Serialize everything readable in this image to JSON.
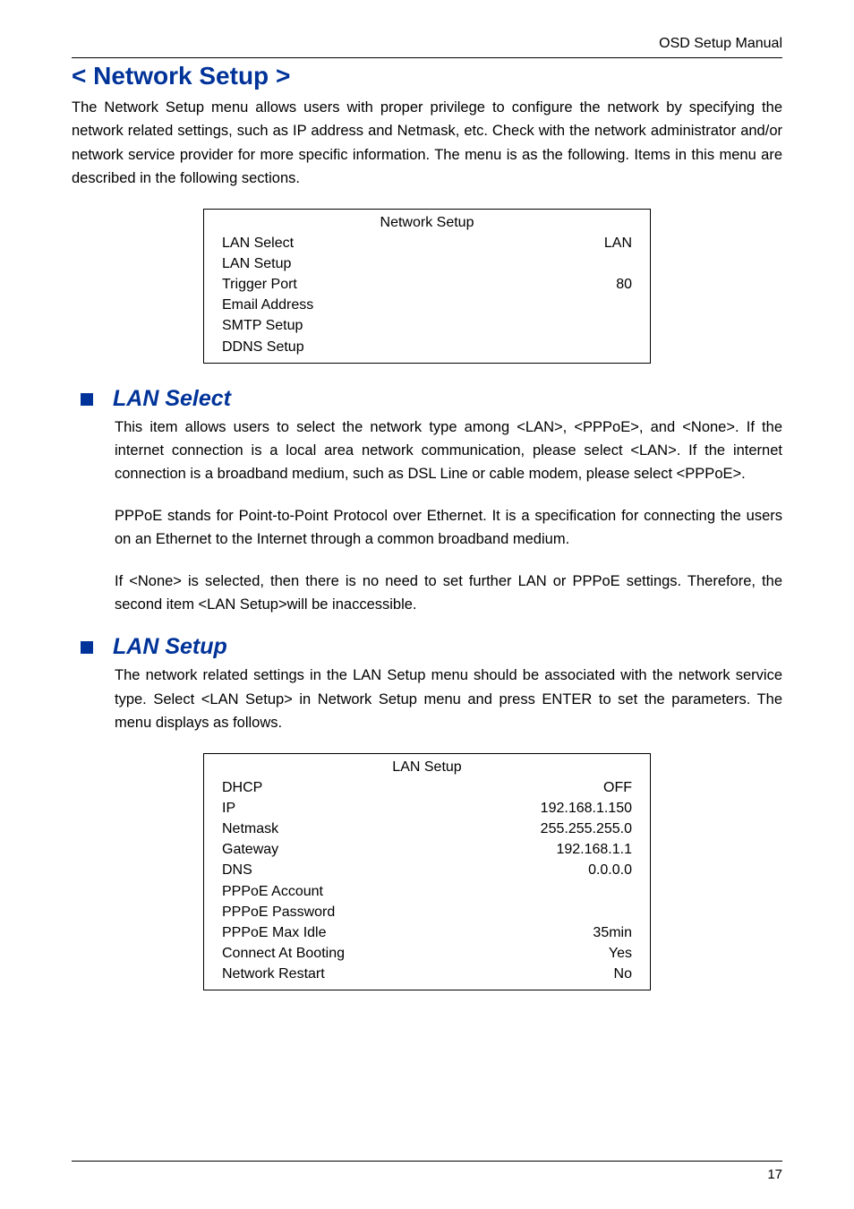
{
  "header": {
    "right_text": "OSD Setup Manual"
  },
  "title": "< Network Setup >",
  "intro_text": "The Network Setup menu allows users with proper privilege to configure the network by specifying the network related settings, such as IP address and Netmask, etc. Check with the network administrator and/or network service provider for more specific information. The menu is as the following. Items in this menu are described in the following sections.",
  "network_setup_table": {
    "title": "Network Setup",
    "rows": [
      {
        "label": "LAN Select",
        "value": "LAN"
      },
      {
        "label": "LAN Setup",
        "value": ""
      },
      {
        "label": "Trigger Port",
        "value": "80"
      },
      {
        "label": "Email Address",
        "value": ""
      },
      {
        "label": "SMTP Setup",
        "value": ""
      },
      {
        "label": "DDNS Setup",
        "value": ""
      }
    ]
  },
  "sections": {
    "lan_select": {
      "title": "LAN Select",
      "p1": "This item allows users to select the network type among <LAN>, <PPPoE>, and <None>. If the internet connection is a local area network communication, please select <LAN>. If the internet connection is a broadband medium, such as DSL Line or cable modem, please select <PPPoE>.",
      "p2": "PPPoE stands for Point-to-Point Protocol over Ethernet.  It is a specification for connecting the users on an Ethernet to the Internet through a common broadband medium.",
      "p3": "If <None> is selected, then there is no need to set further LAN or PPPoE settings. Therefore, the second item <LAN Setup>will be inaccessible."
    },
    "lan_setup": {
      "title": "LAN Setup",
      "p1": "The network related settings in the LAN Setup menu should be associated with the network service type. Select <LAN Setup> in Network Setup menu and press ENTER to set the parameters. The menu displays as follows."
    }
  },
  "lan_setup_table": {
    "title": "LAN Setup",
    "rows": [
      {
        "label": "DHCP",
        "value": "OFF"
      },
      {
        "label": "IP",
        "value": "192.168.1.150"
      },
      {
        "label": "Netmask",
        "value": "255.255.255.0"
      },
      {
        "label": "Gateway",
        "value": "192.168.1.1"
      },
      {
        "label": "DNS",
        "value": "0.0.0.0"
      },
      {
        "label": "PPPoE Account",
        "value": ""
      },
      {
        "label": "PPPoE Password",
        "value": ""
      },
      {
        "label": "PPPoE Max Idle",
        "value": "35min"
      },
      {
        "label": "Connect At Booting",
        "value": "Yes"
      },
      {
        "label": "Network Restart",
        "value": "No"
      }
    ]
  },
  "footer": {
    "page_number": "17"
  }
}
